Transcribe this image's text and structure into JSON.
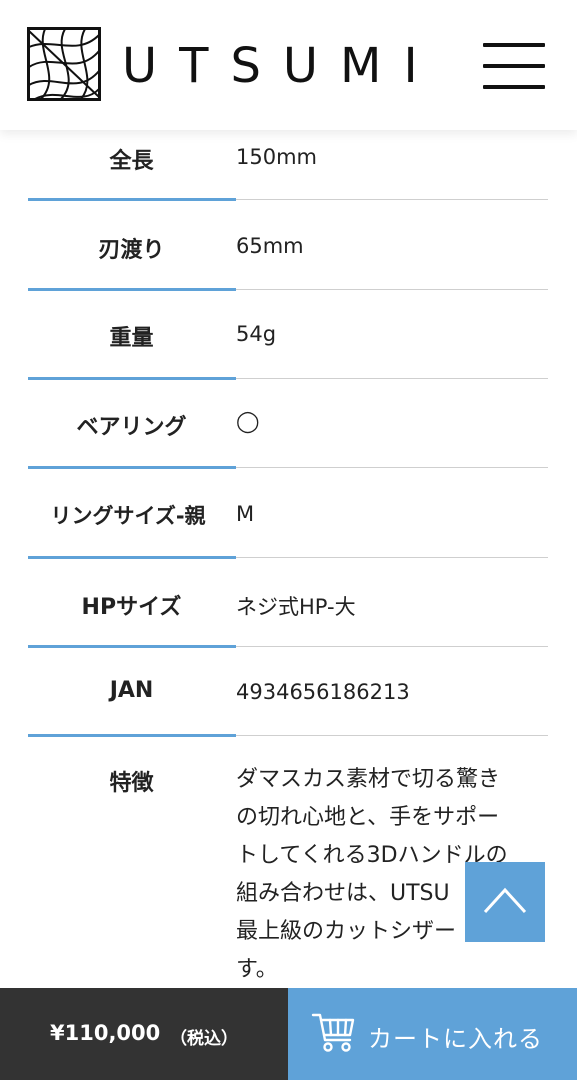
{
  "header": {
    "logo_text": "UTSUMI",
    "logo_icon": "woven-square-logo",
    "menu_icon": "hamburger-menu-icon"
  },
  "spec": [
    {
      "label": "全長",
      "value": "150mm"
    },
    {
      "label": "刃渡り",
      "value": "65mm"
    },
    {
      "label": "重量",
      "value": "54g"
    },
    {
      "label": "ベアリング",
      "value": "◯"
    },
    {
      "label": "リングサイズ-親",
      "value": "M"
    },
    {
      "label": "HPサイズ",
      "value": "ネジ式HP-大"
    },
    {
      "label": "JAN",
      "value": "4934656186213"
    },
    {
      "label": "特徴",
      "value_lines": [
        "ダマスカス素材で切る驚き",
        "の切れ心地と、手をサポー",
        "トしてくれる3Dハンドルの",
        "組み合わせは、UTSU",
        "最上級のカットシザー",
        "す。"
      ]
    }
  ],
  "back_to_top_icon": "chevron-up-icon",
  "footer": {
    "price": "¥110,000",
    "tax": "（税込）",
    "cart_label": "カートに入れる",
    "cart_icon": "cart-icon"
  },
  "colors": {
    "accent": "#5fa2d8",
    "dark": "#333333"
  }
}
